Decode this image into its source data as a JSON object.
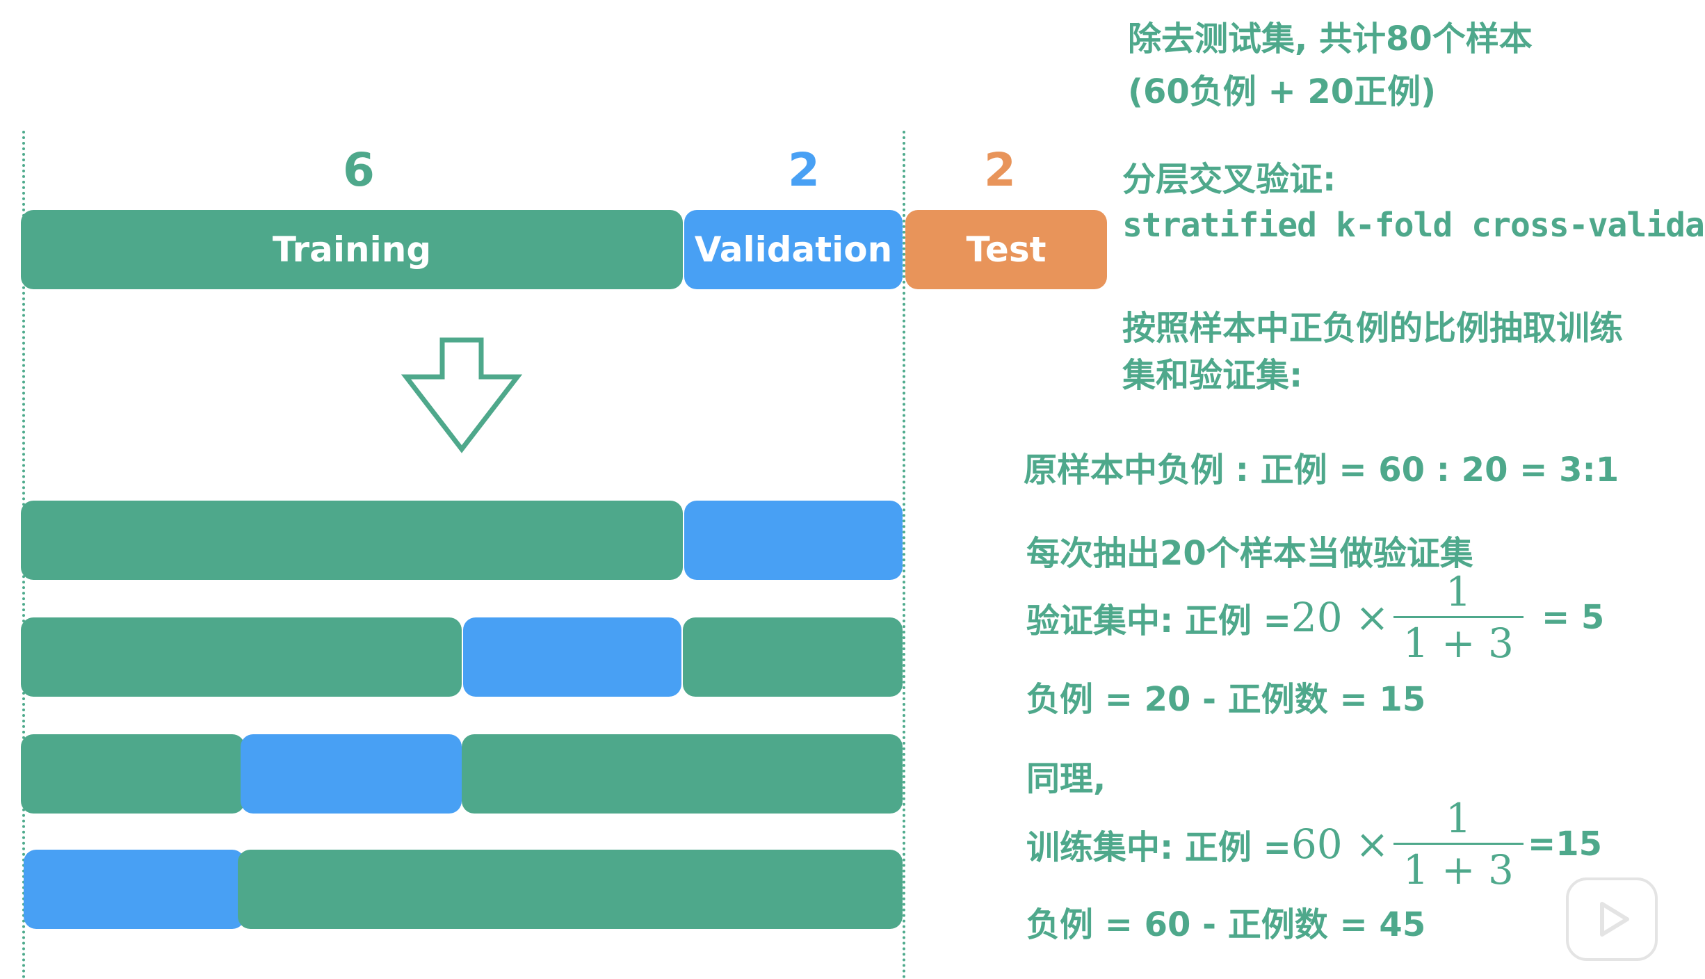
{
  "header_note": {
    "line1": "除去测试集, 共计80个样本",
    "line2": "(60负例 + 20正例)"
  },
  "split": {
    "training_count": "6",
    "validation_count": "2",
    "test_count": "2",
    "training_label": "Training",
    "validation_label": "Validation",
    "test_label": "Test"
  },
  "method": {
    "title_cn": "分层交叉验证:",
    "title_en": "stratified k-fold cross-validation",
    "desc_line1": "按照样本中正负例的比例抽取训练",
    "desc_line2": "集和验证集:"
  },
  "calc": {
    "ratio": "原样本中负例 : 正例  =  60  :  20  =  3:1",
    "per_fold": "每次抽出20个样本当做验证集",
    "val_pos_prefix": "验证集中: 正例 = ",
    "val_pos_mult": "20 ×",
    "val_pos_frac_num": "1",
    "val_pos_frac_den": "1 + 3",
    "val_pos_result": "= 5",
    "val_neg": "负例 = 20 - 正例数 = 15",
    "similarly": "同理,",
    "train_pos_prefix": "训练集中: 正例 = ",
    "train_pos_mult": "60 ×",
    "train_pos_frac_num": "1",
    "train_pos_frac_den": "1 + 3",
    "train_pos_result": "=15",
    "train_neg": "负例 = 60 - 正例数 = 45"
  },
  "colors": {
    "training": "#4ea88b",
    "validation": "#48a0f4",
    "test": "#e8945a",
    "text_green": "#4ea88b",
    "num_blue": "#48a0f4",
    "num_orange": "#e8945a"
  },
  "icons": {
    "down_arrow": "down-arrow-icon",
    "play": "play-icon"
  }
}
